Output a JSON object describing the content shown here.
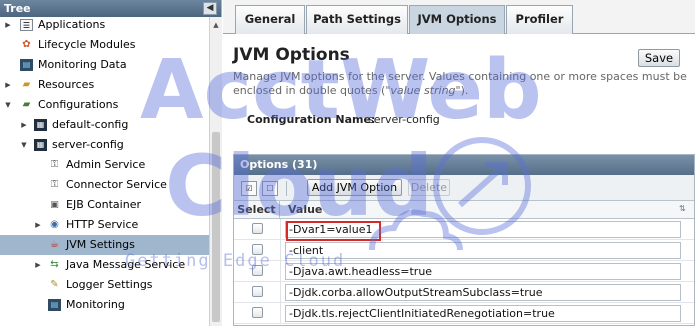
{
  "tree": {
    "title": "Tree",
    "collapse_glyph": "◀",
    "items": [
      {
        "label": "Applications",
        "icon": "folder-icon"
      },
      {
        "label": "Lifecycle Modules",
        "icon": "modules-icon"
      },
      {
        "label": "Monitoring Data",
        "icon": "monitor-icon"
      },
      {
        "label": "Resources",
        "icon": "folder-icon"
      },
      {
        "label": "Configurations",
        "icon": "folder-icon"
      },
      {
        "label": "default-config",
        "icon": "config-icon"
      },
      {
        "label": "server-config",
        "icon": "config-icon"
      },
      {
        "label": "Admin Service",
        "icon": "service-icon"
      },
      {
        "label": "Connector Service",
        "icon": "service-icon"
      },
      {
        "label": "EJB Container",
        "icon": "ejb-icon"
      },
      {
        "label": "HTTP Service",
        "icon": "globe-icon"
      },
      {
        "label": "JVM Settings",
        "icon": "java-icon"
      },
      {
        "label": "Java Message Service",
        "icon": "jms-icon"
      },
      {
        "label": "Logger Settings",
        "icon": "logger-icon"
      },
      {
        "label": "Monitoring",
        "icon": "monitor-icon"
      }
    ]
  },
  "tabs": [
    {
      "label": "General"
    },
    {
      "label": "Path Settings"
    },
    {
      "label": "JVM Options",
      "active": true
    },
    {
      "label": "Profiler"
    }
  ],
  "page": {
    "title": "JVM Options",
    "save_label": "Save",
    "help_prefix": "Manage JVM options for the server. Values containing one or more spaces must be enclosed in double quotes (\"",
    "help_emph": "value string",
    "help_suffix": "\").",
    "config_label": "Configuration Name:",
    "config_value": "server-config"
  },
  "options_table": {
    "title": "Options (31)",
    "add_label": "Add JVM Option",
    "delete_label": "Delete",
    "col_select": "Select",
    "col_value": "Value",
    "rows": [
      {
        "value": "-Dvar1=value1"
      },
      {
        "value": "-client"
      },
      {
        "value": "-Djava.awt.headless=true"
      },
      {
        "value": "-Djdk.corba.allowOutputStreamSubclass=true"
      },
      {
        "value": "-Djdk.tls.rejectClientInitiatedRenegotiation=true"
      }
    ]
  },
  "watermark": {
    "line1": "AcctWeb",
    "line2": "Cloud",
    "tagline": "Getting Edge Cloud"
  },
  "colors": {
    "header": "#5a7590",
    "selected_row": "#9fb6cc",
    "highlight": "#d42a2a",
    "watermark": "#5b6fd8"
  }
}
